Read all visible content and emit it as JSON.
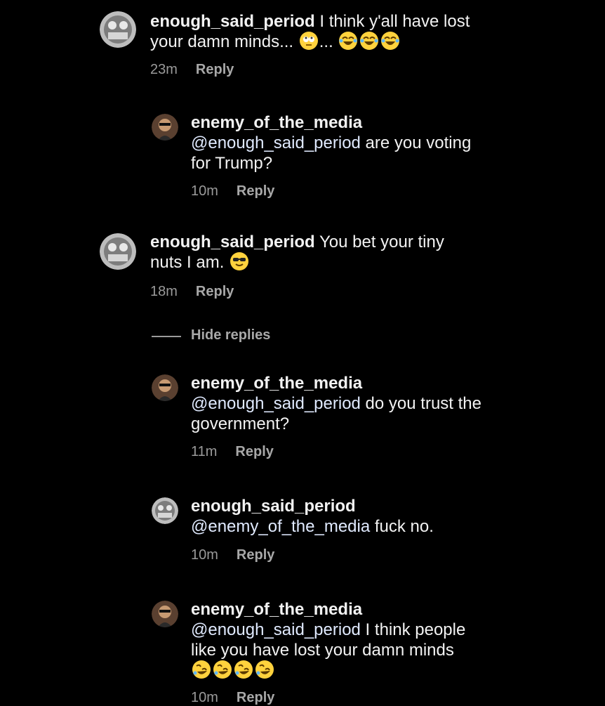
{
  "comments": [
    {
      "username": "enough_said_period",
      "mention": "",
      "text": " I think y'all have lost your damn minds...",
      "text_after": "...",
      "time": "23m",
      "reply": "Reply"
    },
    {
      "username": "enemy_of_the_media",
      "mention": "@enough_said_period",
      "text": " are you voting for Trump?",
      "time": "10m",
      "reply": "Reply"
    },
    {
      "username": "enough_said_period",
      "mention": "",
      "text": " You bet your tiny nuts I am.",
      "time": "18m",
      "reply": "Reply"
    },
    {
      "username": "enemy_of_the_media",
      "mention": "@enough_said_period",
      "text": " do you trust the government?",
      "time": "11m",
      "reply": "Reply"
    },
    {
      "username": "enough_said_period",
      "mention": "@enemy_of_the_media",
      "text": " fuck no.",
      "time": "10m",
      "reply": "Reply"
    },
    {
      "username": "enemy_of_the_media",
      "mention": "@enough_said_period",
      "text": " I think people like you have lost your damn minds",
      "time": "10m",
      "reply": "Reply"
    }
  ],
  "hide_replies": "Hide replies",
  "emoji_icons": [
    "rolling-eyes-emoji",
    "joy-emoji",
    "sunglasses-emoji",
    "rofl-emoji"
  ]
}
